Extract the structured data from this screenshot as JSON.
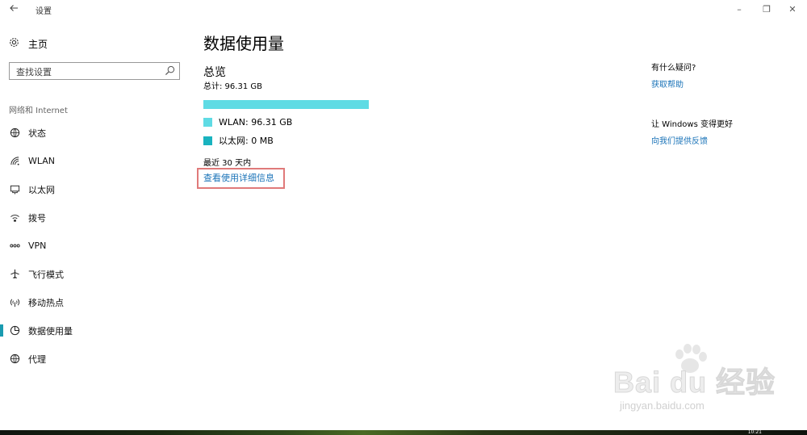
{
  "window": {
    "title": "设置",
    "back_icon": "back-arrow-icon",
    "minimize_glyph": "–",
    "maximize_glyph": "❐",
    "close_glyph": "✕"
  },
  "sidebar": {
    "home_label": "主页",
    "search_placeholder": "查找设置",
    "section_title": "网络和 Internet",
    "items": [
      {
        "label": "状态",
        "icon": "globe-status-icon"
      },
      {
        "label": "WLAN",
        "icon": "wifi-icon"
      },
      {
        "label": "以太网",
        "icon": "ethernet-icon"
      },
      {
        "label": "拨号",
        "icon": "dialup-icon"
      },
      {
        "label": "VPN",
        "icon": "vpn-icon"
      },
      {
        "label": "飞行模式",
        "icon": "airplane-icon"
      },
      {
        "label": "移动热点",
        "icon": "hotspot-icon"
      },
      {
        "label": "数据使用量",
        "icon": "data-usage-icon",
        "active": true
      },
      {
        "label": "代理",
        "icon": "globe-icon"
      }
    ]
  },
  "main": {
    "title": "数据使用量",
    "overview_heading": "总览",
    "total_text": "总计: 96.31 GB",
    "usage_fraction": 1.0,
    "legend": [
      {
        "label": "WLAN:   96.31 GB",
        "color": "#5fdbe4"
      },
      {
        "label": "以太网:   0 MB",
        "color": "#19b3bf"
      }
    ],
    "period_text": "最近 30 天内",
    "details_link": "查看使用详细信息"
  },
  "help_panel": {
    "question_heading": "有什么疑问?",
    "get_help_link": "获取帮助",
    "improve_heading": "让 Windows 变得更好",
    "feedback_link": "向我们提供反馈"
  },
  "watermark": {
    "brand": "Bai du 经验",
    "url": "jingyan.baidu.com"
  },
  "taskbar": {
    "clock": "10:21"
  },
  "colors": {
    "accent": "#1a9bb0",
    "link": "#1a73b8",
    "highlight_box": "#e07a7a"
  }
}
